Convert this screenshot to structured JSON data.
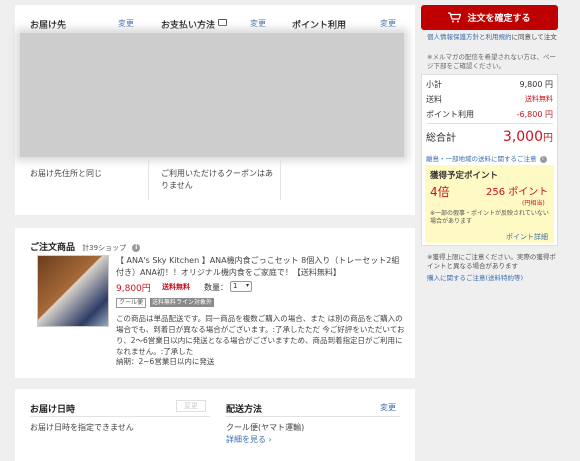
{
  "top": {
    "delivery_header": "お届け先",
    "delivery_change": "変更",
    "payment_header": "お支払い方法",
    "payment_change": "変更",
    "points_header": "ポイント利用",
    "points_change": "変更",
    "delivery_note": "お届け先住所と同じ",
    "coupon_note": "ご利用いただけるクーポンはありません"
  },
  "order": {
    "header": "ご注文商品",
    "shop_count": "計39ショップ",
    "product_title": "【 ANA's Sky Kitchen 】ANA機内食ごっこセット 8個入り（トレーセット2組付き）ANA初！！オリジナル機内食をご家庭で！【送料無料】",
    "price": "9,800円",
    "shipping": "送料無料",
    "qty_label": "数量：",
    "qty_value": "1",
    "tag1": "クール便",
    "tag2": "送料無料ライン対象外",
    "note": "この商品は単品配送です。同一商品を複数ご購入の場合、また は別の商品をご購入の場合でも、到着日が異なる場合がございます。:了承したただ 今ご好評をいただいており、2〜6営業日以内に発送となる場合がございますため、商品到着指定日がご利用になれません。:了承した",
    "delivery_time": "納期：2~6営業日以内に発送"
  },
  "delivery_date": {
    "header": "お届け日時",
    "change": "変更",
    "note": "お届け日時を指定できません"
  },
  "shipping_method": {
    "header": "配送方法",
    "change": "変更",
    "value": "クール便(ヤマト運輸)",
    "details": "詳細を見る"
  },
  "sidebar": {
    "confirm_button": "注文を確定する",
    "privacy_link": "個人情報保護方針と利用規約",
    "privacy_text": "に同意して注文",
    "mailmag_note": "※メルマガの配信を希望されない方は、ページ下部をご確認ください。",
    "subtotal_label": "小計",
    "subtotal_value": "9,800 円",
    "shipping_label": "送料",
    "shipping_value": "送料無料",
    "points_label": "ポイント利用",
    "points_value": "-6,800 円",
    "total_label": "総合計",
    "total_value": "3,000",
    "total_unit": "円",
    "remote_note": "離島・一部地域の送料に関するご注意",
    "earn_title": "獲得予定ポイント",
    "earn_multiplier": "4倍",
    "earn_points": "256 ポイント",
    "earn_yen": "(円相当)",
    "earn_note": "※一部の假事・ポイントが反映されていない場合があります",
    "earn_details": "ポイント詳細",
    "points_bottom_note": "※獲得上限にご注意ください。実際の獲得ポイントと異なる場合があります",
    "points_bottom_link": "購入に関するご注意(送料特約等)"
  },
  "colors": {
    "accent": "#bf0000",
    "link": "#3a6fb0",
    "earn_bg": "#fff9c4"
  }
}
